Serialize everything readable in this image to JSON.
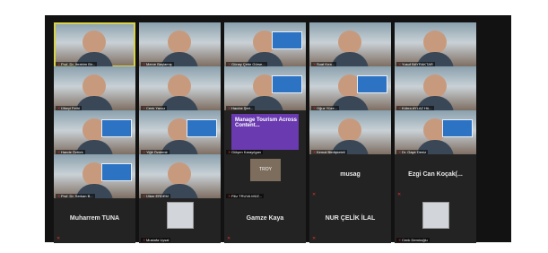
{
  "tiles": [
    {
      "label": "Prof. Dr. İbrahim Bir...",
      "type": "video",
      "active": true
    },
    {
      "label": "Merve Başlamış",
      "type": "video"
    },
    {
      "label": "Günay Çetin Gürse...",
      "type": "video"
    },
    {
      "label": "Suat Kıra...",
      "type": "video"
    },
    {
      "label": "Yusuf BAYRAKTAR",
      "type": "video"
    },
    {
      "label": "Ülkeyi Fethi",
      "type": "video"
    },
    {
      "label": "Cenk Yavuz",
      "type": "video"
    },
    {
      "label": "Hacıbe Şeri...",
      "type": "video"
    },
    {
      "label": "Oğuz Yüze...",
      "type": "video"
    },
    {
      "label": "Kübra AYLAZ Hü...",
      "type": "video"
    },
    {
      "label": "Hande Öztürk",
      "type": "video"
    },
    {
      "label": "Yiğit Özdemir",
      "type": "video"
    },
    {
      "label": "Gülşen Karayılgan",
      "type": "manage",
      "overlay": "Manage Tourism Across Content..."
    },
    {
      "label": "Kemal Birdişkeleli",
      "type": "video"
    },
    {
      "label": "Dr. Gaye Deniz",
      "type": "video"
    },
    {
      "label": "Prof. Dr. Serkan B...",
      "type": "video"
    },
    {
      "label": "Ülker ERDEM",
      "type": "video"
    },
    {
      "label": "Filiz TRUVA MÜZ...",
      "type": "troy",
      "overlay": "TROY"
    },
    {
      "label": "",
      "type": "name",
      "name": "musag"
    },
    {
      "label": "",
      "type": "name",
      "name": "Ezgi Can Koçak(..."
    },
    {
      "label": "",
      "type": "name",
      "name": "Muharrem TUNA"
    },
    {
      "label": "Mustafa Uysal",
      "type": "photo"
    },
    {
      "label": "",
      "type": "name",
      "name": "Gamze Kaya"
    },
    {
      "label": "",
      "type": "name",
      "name": "NUR ÇELİK İLAL"
    },
    {
      "label": "Cenk Demiroğlu",
      "type": "photo"
    }
  ]
}
